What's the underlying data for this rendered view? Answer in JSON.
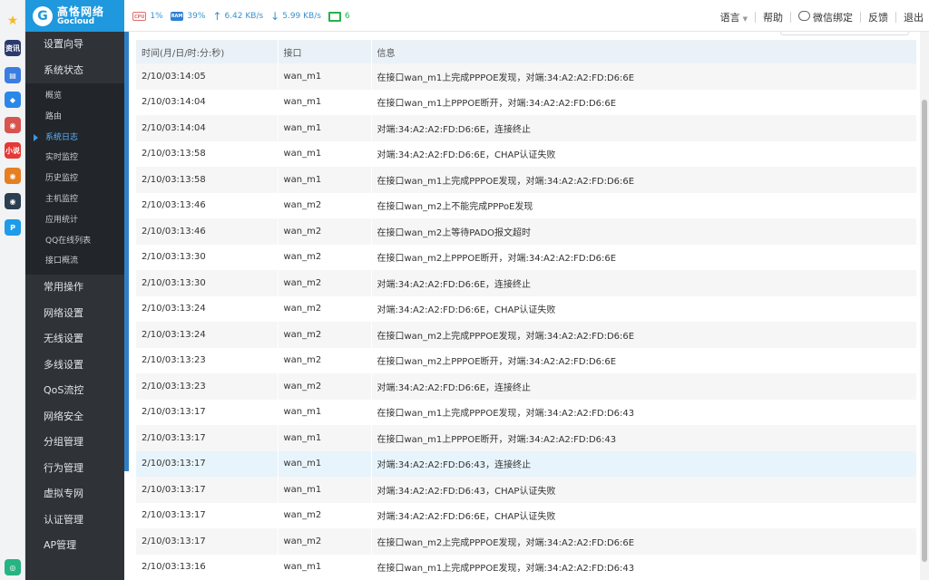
{
  "dock": [
    {
      "icon": "star-icon",
      "color": "#f7b92b",
      "glyph": "★"
    },
    {
      "icon": "news-app-icon",
      "color": "#2a3a6b",
      "glyph": "资讯"
    },
    {
      "icon": "document-icon",
      "color": "#3b7de0",
      "glyph": "▤"
    },
    {
      "icon": "chat-app-icon",
      "color": "#2b88e8",
      "glyph": "◆"
    },
    {
      "icon": "game-app-icon-1",
      "color": "#d9534f",
      "glyph": "◉"
    },
    {
      "icon": "xiaoshuo-app-icon",
      "color": "#e53935",
      "glyph": "小说"
    },
    {
      "icon": "game-app-icon-2",
      "color": "#e67e22",
      "glyph": "◉"
    },
    {
      "icon": "game-app-icon-3",
      "color": "#2c3e50",
      "glyph": "◉"
    },
    {
      "icon": "p-app-icon",
      "color": "#1e9be9",
      "glyph": "P"
    },
    {
      "icon": "bottom-app-icon",
      "color": "#27b383",
      "glyph": "◎"
    }
  ],
  "brand": {
    "cn": "高恪网络",
    "en": "Gocloud",
    "logo_glyph": "G",
    "color": "#1f98dd"
  },
  "stats": {
    "cpu_label": "CPU",
    "cpu": "1%",
    "ram_label": "RAM",
    "ram": "39%",
    "upload": "6.42 KB/s",
    "download": "5.99 KB/s",
    "online": "6"
  },
  "topnav": {
    "language": "语言",
    "help": "帮助",
    "wechat": "微信绑定",
    "feedback": "反馈",
    "logout": "退出"
  },
  "sidebar": {
    "top_items": [
      "设置向导",
      "系统状态"
    ],
    "sub_items": [
      "概览",
      "路由",
      "系统日志",
      "实时监控",
      "历史监控",
      "主机监控",
      "应用统计",
      "QQ在线列表",
      "接口概流"
    ],
    "active_sub": 2,
    "bottom_items": [
      "常用操作",
      "网络设置",
      "无线设置",
      "多线设置",
      "QoS流控",
      "网络安全",
      "分组管理",
      "行为管理",
      "虚拟专网",
      "认证管理",
      "AP管理"
    ]
  },
  "table": {
    "columns": [
      "时间(月/日/时:分:秒)",
      "接口",
      "信息"
    ],
    "highlight_row": 15,
    "rows": [
      [
        "2/10/03:14:05",
        "wan_m1",
        "在接口wan_m1上完成PPPOE发现，对端:34:A2:A2:FD:D6:6E"
      ],
      [
        "2/10/03:14:04",
        "wan_m1",
        "在接口wan_m1上PPPOE断开，对端:34:A2:A2:FD:D6:6E"
      ],
      [
        "2/10/03:14:04",
        "wan_m1",
        "对端:34:A2:A2:FD:D6:6E，连接终止"
      ],
      [
        "2/10/03:13:58",
        "wan_m1",
        "对端:34:A2:A2:FD:D6:6E，CHAP认证失败"
      ],
      [
        "2/10/03:13:58",
        "wan_m1",
        "在接口wan_m1上完成PPPOE发现，对端:34:A2:A2:FD:D6:6E"
      ],
      [
        "2/10/03:13:46",
        "wan_m2",
        "在接口wan_m2上不能完成PPPoE发现"
      ],
      [
        "2/10/03:13:46",
        "wan_m2",
        "在接口wan_m2上等待PADO报文超时"
      ],
      [
        "2/10/03:13:30",
        "wan_m2",
        "在接口wan_m2上PPPOE断开，对端:34:A2:A2:FD:D6:6E"
      ],
      [
        "2/10/03:13:30",
        "wan_m2",
        "对端:34:A2:A2:FD:D6:6E，连接终止"
      ],
      [
        "2/10/03:13:24",
        "wan_m2",
        "对端:34:A2:A2:FD:D6:6E，CHAP认证失败"
      ],
      [
        "2/10/03:13:24",
        "wan_m2",
        "在接口wan_m2上完成PPPOE发现，对端:34:A2:A2:FD:D6:6E"
      ],
      [
        "2/10/03:13:23",
        "wan_m2",
        "在接口wan_m2上PPPOE断开，对端:34:A2:A2:FD:D6:6E"
      ],
      [
        "2/10/03:13:23",
        "wan_m2",
        "对端:34:A2:A2:FD:D6:6E，连接终止"
      ],
      [
        "2/10/03:13:17",
        "wan_m1",
        "在接口wan_m1上完成PPPOE发现，对端:34:A2:A2:FD:D6:43"
      ],
      [
        "2/10/03:13:17",
        "wan_m1",
        "在接口wan_m1上PPPOE断开，对端:34:A2:A2:FD:D6:43"
      ],
      [
        "2/10/03:13:17",
        "wan_m1",
        "对端:34:A2:A2:FD:D6:43，连接终止"
      ],
      [
        "2/10/03:13:17",
        "wan_m1",
        "对端:34:A2:A2:FD:D6:43，CHAP认证失败"
      ],
      [
        "2/10/03:13:17",
        "wan_m2",
        "对端:34:A2:A2:FD:D6:6E，CHAP认证失败"
      ],
      [
        "2/10/03:13:17",
        "wan_m2",
        "在接口wan_m2上完成PPPOE发现，对端:34:A2:A2:FD:D6:6E"
      ],
      [
        "2/10/03:13:16",
        "wan_m1",
        "在接口wan_m1上完成PPPOE发现，对端:34:A2:A2:FD:D6:43"
      ]
    ]
  }
}
